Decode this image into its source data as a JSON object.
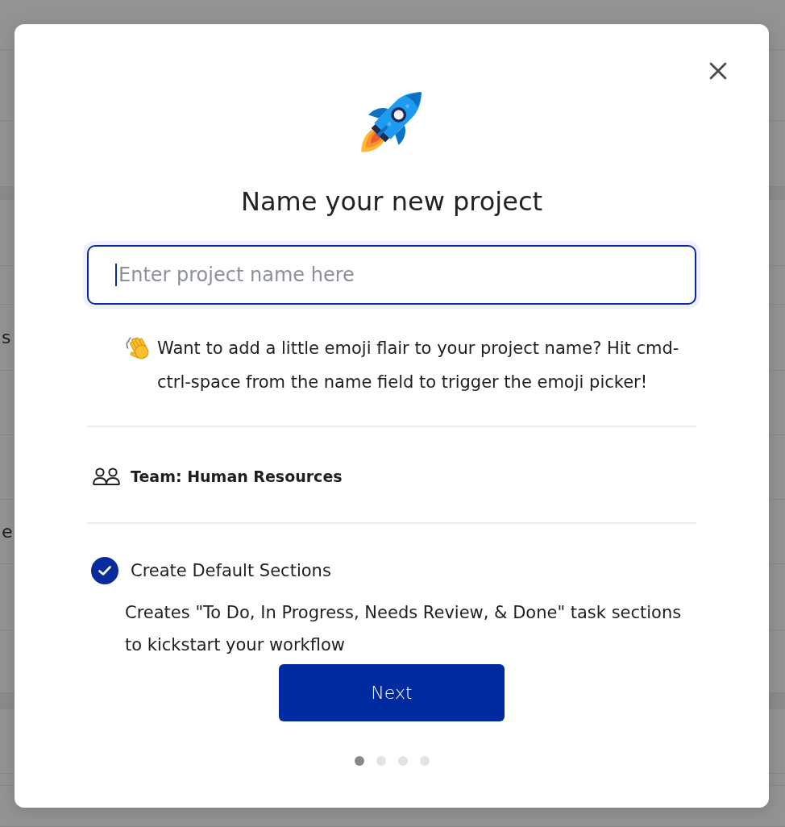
{
  "background": {
    "row_texts": [
      "s",
      "e"
    ]
  },
  "dialog": {
    "title": "Name your new project",
    "name_field": {
      "placeholder": "Enter project name here",
      "focused": true
    },
    "emoji_tip": "Want to add a little emoji flair to your project name? Hit cmd-ctrl-space from the name field to trigger the emoji picker!",
    "team": "Team: Human Resources",
    "default_sections": {
      "label": "Create Default Sections",
      "checked": true,
      "description": "Creates \"To Do, In Progress, Needs Review, & Done\" task sections to kickstart your workflow"
    },
    "next_button": "Next",
    "steps": [
      {
        "selected": true
      },
      {
        "selected": false
      },
      {
        "selected": false
      },
      {
        "selected": false
      }
    ]
  }
}
